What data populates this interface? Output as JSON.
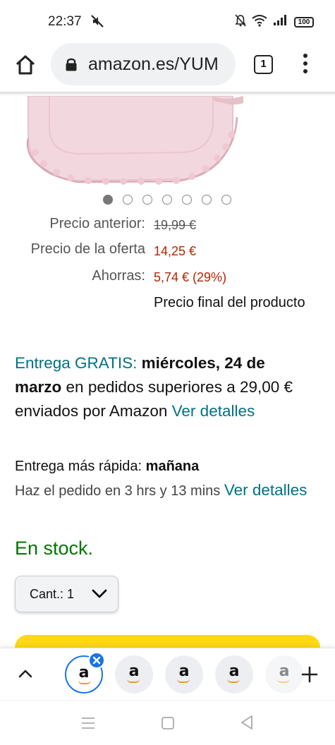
{
  "status_bar": {
    "time": "22:37",
    "battery": "100"
  },
  "browser": {
    "url": "amazon.es/YUM",
    "tab_count": "1",
    "icons": [
      "home-icon",
      "lock-icon",
      "tabs-icon",
      "more-vert-icon"
    ]
  },
  "product": {
    "image_alt": "pink baby blanket with lace trim",
    "carousel": {
      "total": 7,
      "active_index": 0
    }
  },
  "pricing": {
    "previous_label": "Precio anterior:",
    "previous_value": "19,99 €",
    "deal_label": "Precio de la oferta",
    "deal_value": "14,25 €",
    "savings_label": "Ahorras:",
    "savings_value": "5,74 € (29%)",
    "final_note": "Precio final del producto"
  },
  "delivery": {
    "free_label": "Entrega GRATIS:",
    "date": "miércoles, 24 de marzo",
    "condition": "en pedidos superiores a 29,00 € enviados por Amazon",
    "details_link": "Ver detalles"
  },
  "fast_delivery": {
    "label": "Entrega más rápida:",
    "when": "mañana",
    "order_within": "Haz el pedido en 3 hrs y 13 mins",
    "details_link": "Ver detalles"
  },
  "stock": "En stock.",
  "quantity": {
    "label": "Cant.:",
    "value": "1"
  },
  "tab_group": {
    "tabs": [
      {
        "letter": "a",
        "selected": true
      },
      {
        "letter": "a",
        "selected": false
      },
      {
        "letter": "a",
        "selected": false
      },
      {
        "letter": "a",
        "selected": false
      },
      {
        "letter": "a",
        "selected": false
      }
    ]
  },
  "colors": {
    "link": "#007185",
    "price_red": "#b12704",
    "in_stock_green": "#007600",
    "buy_yellow": "#ffd814",
    "accent_blue": "#1a73e8"
  }
}
